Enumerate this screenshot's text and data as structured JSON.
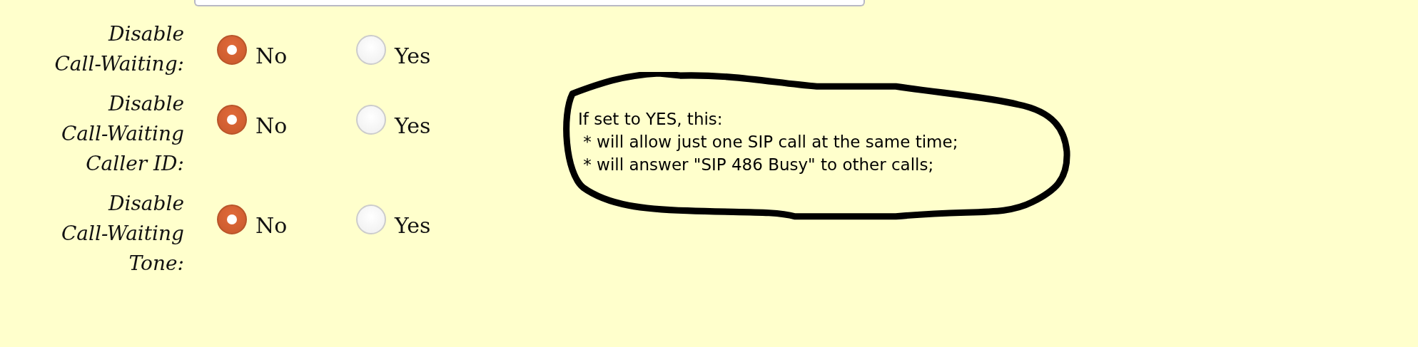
{
  "settings": [
    {
      "label_lines": [
        "Disable",
        "Call-Waiting:"
      ],
      "options": [
        {
          "label": "No",
          "selected": true
        },
        {
          "label": "Yes",
          "selected": false
        }
      ]
    },
    {
      "label_lines": [
        "Disable",
        "Call-Waiting",
        "Caller ID:"
      ],
      "options": [
        {
          "label": "No",
          "selected": true
        },
        {
          "label": "Yes",
          "selected": false
        }
      ]
    },
    {
      "label_lines": [
        "Disable",
        "Call-Waiting",
        "Tone:"
      ],
      "options": [
        {
          "label": "No",
          "selected": true
        },
        {
          "label": "Yes",
          "selected": false
        }
      ]
    }
  ],
  "annotation": {
    "lines": [
      "If set to YES, this:",
      " * will allow just one SIP call at the same time;",
      " * will answer \"SIP 486 Busy\" to other calls;"
    ]
  }
}
